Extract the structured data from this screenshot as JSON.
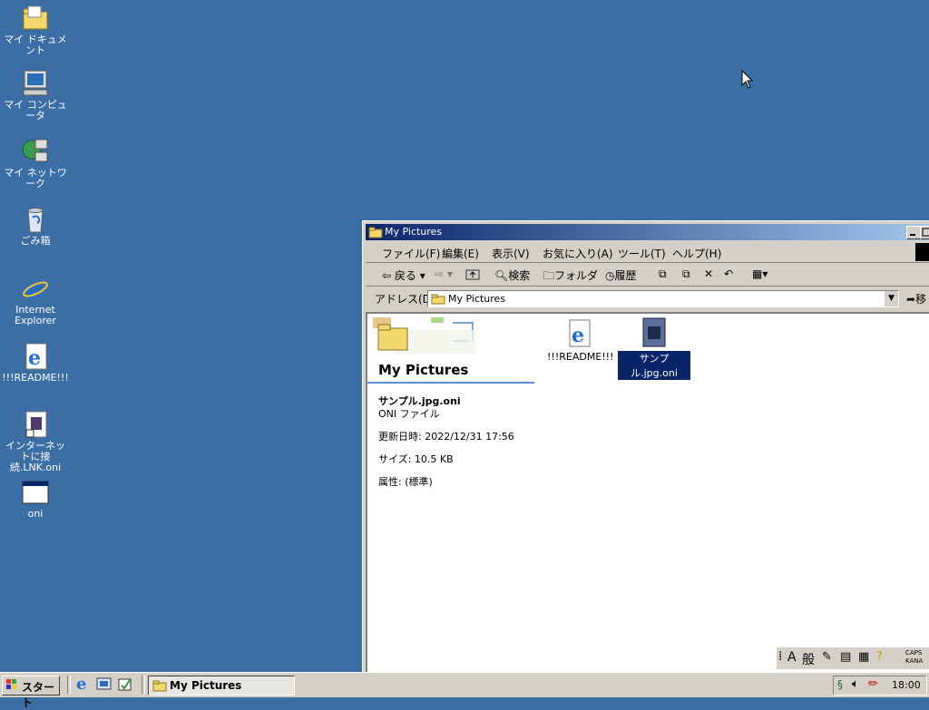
{
  "desktop": {
    "icons": [
      {
        "label": "マイ ドキュメント",
        "icon": "folder-icon"
      },
      {
        "label": "マイ コンピュータ",
        "icon": "computer-icon"
      },
      {
        "label": "マイ ネットワーク",
        "icon": "network-icon"
      },
      {
        "label": "ごみ箱",
        "icon": "recycle-bin-icon"
      },
      {
        "label": "Internet Explorer",
        "icon": "ie-icon"
      },
      {
        "label": "!!!README!!!",
        "icon": "ie-document-icon"
      },
      {
        "label": "インターネットに接続.LNK.oni",
        "icon": "shortcut-file-icon"
      },
      {
        "label": "oni",
        "icon": "window-app-icon"
      }
    ]
  },
  "window": {
    "title": "My Pictures",
    "menu": [
      "ファイル(F)",
      "編集(E)",
      "表示(V)",
      "お気に入り(A)",
      "ツール(T)",
      "ヘルプ(H)"
    ],
    "toolbar": {
      "back": "戻る",
      "search": "検索",
      "folders": "フォルダ",
      "history": "履歴"
    },
    "address_label": "アドレス(D)",
    "address_value": "My Pictures",
    "go_label": "移",
    "sidebar": {
      "folder_title": "My Pictures",
      "file_name": "サンプル.jpg.oni",
      "file_type": "ONI ファイル",
      "modified": "更新日時: 2022/12/31 17:56",
      "size": "サイズ: 10.5 KB",
      "attributes": "属性: (標準)"
    },
    "files": [
      {
        "name": "!!!README!!!",
        "icon": "ie-document-icon",
        "selected": false
      },
      {
        "name": "サンプル.jpg.oni",
        "icon": "oni-file-icon",
        "selected": true
      }
    ]
  },
  "ime_bar": {
    "mode": "般",
    "caps": "CAPS",
    "kana": "KANA"
  },
  "taskbar": {
    "start_label": "スタート",
    "task_label": "My Pictures",
    "clock": "18:00"
  },
  "colors": {
    "desktop": "#3a6ea5",
    "title_active": "#0a246a",
    "selection": "#0a246a"
  }
}
